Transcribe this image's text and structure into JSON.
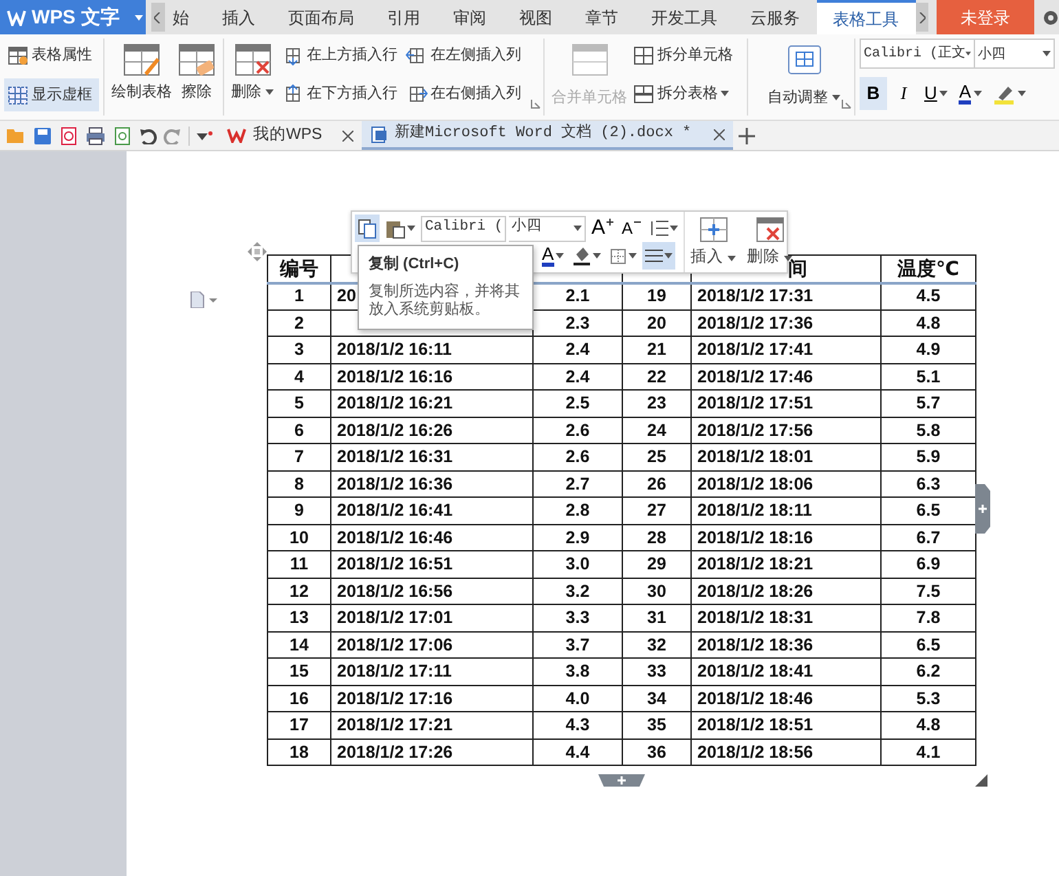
{
  "app": {
    "title": "WPS 文字"
  },
  "menu_tabs": [
    {
      "label": "始",
      "selected": false
    },
    {
      "label": "插入",
      "selected": false
    },
    {
      "label": "页面布局",
      "selected": false
    },
    {
      "label": "引用",
      "selected": false
    },
    {
      "label": "审阅",
      "selected": false
    },
    {
      "label": "视图",
      "selected": false
    },
    {
      "label": "章节",
      "selected": false
    },
    {
      "label": "开发工具",
      "selected": false
    },
    {
      "label": "云服务",
      "selected": false
    },
    {
      "label": "表格工具",
      "selected": true
    }
  ],
  "login_button": {
    "label": "未登录"
  },
  "ribbon": {
    "view_buttons": [
      {
        "label": "表格属性",
        "kind": "properties",
        "selected": false
      },
      {
        "label": "显示虚框",
        "kind": "gridlines",
        "selected": true
      }
    ],
    "large_buttons": [
      {
        "label": "绘制表格",
        "kind": "draw",
        "dropdown": false
      },
      {
        "label": "擦除",
        "kind": "erase",
        "dropdown": false
      },
      {
        "label": "删除",
        "kind": "delete",
        "dropdown": true
      }
    ],
    "insert_buttons": [
      {
        "label": "在上方插入行",
        "kind": "row-above"
      },
      {
        "label": "在下方插入行",
        "kind": "row-below"
      },
      {
        "label": "在左侧插入列",
        "kind": "col-left"
      },
      {
        "label": "在右侧插入列",
        "kind": "col-right"
      }
    ],
    "merge_button": {
      "label": "合并单元格",
      "disabled": true
    },
    "split_buttons": [
      {
        "label": "拆分单元格",
        "dropdown": false
      },
      {
        "label": "拆分表格",
        "dropdown": true
      }
    ],
    "autofit_button": {
      "label": "自动调整",
      "dropdown": true
    },
    "font": {
      "name": "Calibri (正文",
      "size": "小四"
    },
    "format_buttons": [
      {
        "label": "B",
        "kind": "bold",
        "selected": true,
        "dropdown": false
      },
      {
        "label": "I",
        "kind": "italic",
        "selected": false,
        "dropdown": false
      },
      {
        "label": "U",
        "kind": "underline",
        "selected": false,
        "dropdown": true
      },
      {
        "label": "A",
        "kind": "color",
        "selected": false,
        "dropdown": true
      },
      {
        "kind": "highlight",
        "selected": false,
        "dropdown": true
      }
    ]
  },
  "doc_tabs": [
    {
      "label": "我的WPS",
      "kind": "home",
      "selected": false
    },
    {
      "label": "新建Microsoft Word 文档 (2).docx *",
      "kind": "document",
      "selected": true
    }
  ],
  "float_toolbar": {
    "font": "Calibri (",
    "size": "小四",
    "row1_tools": [
      {
        "kind": "copy",
        "selected": true,
        "dropdown": false
      },
      {
        "kind": "paste",
        "selected": false,
        "dropdown": true
      }
    ],
    "size_buttons": [
      {
        "label": "A",
        "kind": "grow"
      },
      {
        "label": "A",
        "kind": "shrink"
      }
    ],
    "row2_tools": [
      {
        "kind": "font-color",
        "label": "A",
        "selected": false
      },
      {
        "kind": "fill",
        "selected": false
      },
      {
        "kind": "border",
        "selected": false
      },
      {
        "kind": "align",
        "selected": true
      }
    ],
    "buttons": [
      {
        "label": "插入",
        "kind": "insert"
      },
      {
        "label": "删除",
        "kind": "delete"
      }
    ]
  },
  "tooltip": {
    "title": "复制 (Ctrl+C)",
    "text": "复制所选内容，并将其放入系统剪贴板。"
  },
  "table": {
    "header": {
      "column_1": "编号",
      "column_5": "间",
      "column_6": "温度℃"
    },
    "rows": [
      [
        "1",
        "20",
        "2.1",
        "19",
        "2018/1/2 17:31",
        "4.5"
      ],
      [
        "2",
        null,
        "2.3",
        "20",
        "2018/1/2 17:36",
        "4.8"
      ],
      [
        "3",
        "2018/1/2 16:11",
        "2.4",
        "21",
        "2018/1/2 17:41",
        "4.9"
      ],
      [
        "4",
        "2018/1/2 16:16",
        "2.4",
        "22",
        "2018/1/2 17:46",
        "5.1"
      ],
      [
        "5",
        "2018/1/2 16:21",
        "2.5",
        "23",
        "2018/1/2 17:51",
        "5.7"
      ],
      [
        "6",
        "2018/1/2 16:26",
        "2.6",
        "24",
        "2018/1/2 17:56",
        "5.8"
      ],
      [
        "7",
        "2018/1/2 16:31",
        "2.6",
        "25",
        "2018/1/2 18:01",
        "5.9"
      ],
      [
        "8",
        "2018/1/2 16:36",
        "2.7",
        "26",
        "2018/1/2 18:06",
        "6.3"
      ],
      [
        "9",
        "2018/1/2 16:41",
        "2.8",
        "27",
        "2018/1/2 18:11",
        "6.5"
      ],
      [
        "10",
        "2018/1/2 16:46",
        "2.9",
        "28",
        "2018/1/2 18:16",
        "6.7"
      ],
      [
        "11",
        "2018/1/2 16:51",
        "3.0",
        "29",
        "2018/1/2 18:21",
        "6.9"
      ],
      [
        "12",
        "2018/1/2 16:56",
        "3.2",
        "30",
        "2018/1/2 18:26",
        "7.5"
      ],
      [
        "13",
        "2018/1/2 17:01",
        "3.3",
        "31",
        "2018/1/2 18:31",
        "7.8"
      ],
      [
        "14",
        "2018/1/2 17:06",
        "3.7",
        "32",
        "2018/1/2 18:36",
        "6.5"
      ],
      [
        "15",
        "2018/1/2 17:11",
        "3.8",
        "33",
        "2018/1/2 18:41",
        "6.2"
      ],
      [
        "16",
        "2018/1/2 17:16",
        "4.0",
        "34",
        "2018/1/2 18:46",
        "5.3"
      ],
      [
        "17",
        "2018/1/2 17:21",
        "4.3",
        "35",
        "2018/1/2 18:51",
        "4.8"
      ],
      [
        "18",
        "2018/1/2 17:26",
        "4.4",
        "36",
        "2018/1/2 18:56",
        "4.1"
      ]
    ]
  }
}
